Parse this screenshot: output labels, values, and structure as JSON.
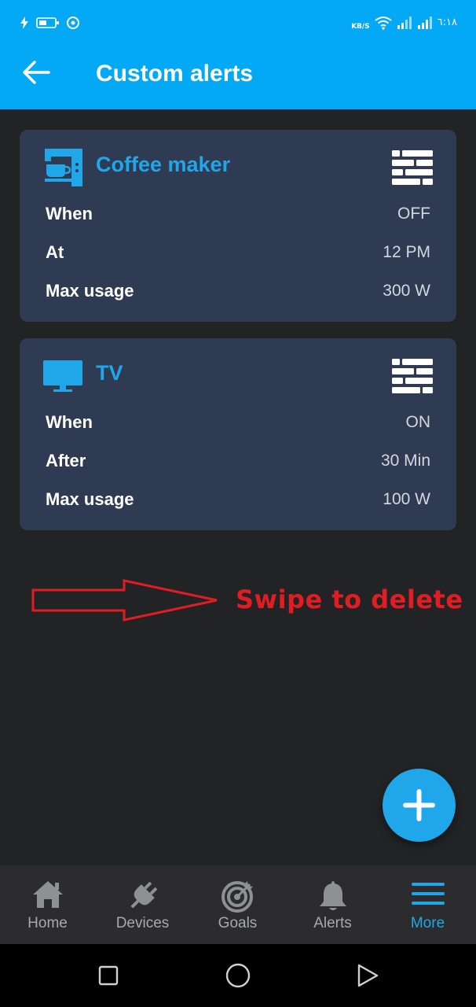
{
  "status_bar": {
    "speed_unit": "KB/S",
    "time": "٦:١٨"
  },
  "header": {
    "title": "Custom alerts",
    "back_icon": "arrow-left-icon"
  },
  "alerts": [
    {
      "name": "Coffee maker",
      "icon": "coffee-maker-icon",
      "rows": [
        {
          "label": "When",
          "value": "OFF"
        },
        {
          "label": "At",
          "value": "12 PM"
        },
        {
          "label": "Max usage",
          "value": "300 W"
        }
      ]
    },
    {
      "name": "TV",
      "icon": "tv-icon",
      "rows": [
        {
          "label": "When",
          "value": "ON"
        },
        {
          "label": "After",
          "value": "30 Min"
        },
        {
          "label": "Max usage",
          "value": "100 W"
        }
      ]
    }
  ],
  "hint": {
    "text": "Swipe to delete"
  },
  "bottom_nav": {
    "items": [
      {
        "label": "Home",
        "icon": "home-icon"
      },
      {
        "label": "Devices",
        "icon": "plug-icon"
      },
      {
        "label": "Goals",
        "icon": "target-icon"
      },
      {
        "label": "Alerts",
        "icon": "bell-icon"
      },
      {
        "label": "More",
        "icon": "menu-icon"
      }
    ],
    "active": "More"
  },
  "colors": {
    "app_bar": "#03a9f4",
    "accent": "#1fa7ea",
    "background": "#222325",
    "card": "#2f3b52",
    "hint_red": "#e11d24"
  }
}
